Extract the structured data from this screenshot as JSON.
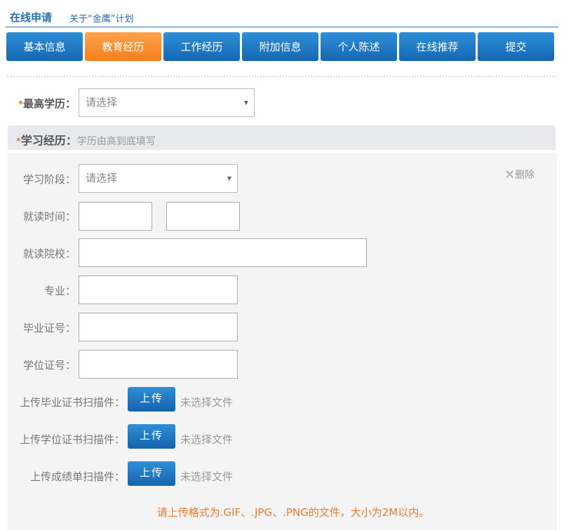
{
  "header": {
    "title": "在线申请",
    "about": "关于“金鹰”计划"
  },
  "tabs": [
    {
      "label": "基本信息",
      "active": false
    },
    {
      "label": "教育经历",
      "active": true
    },
    {
      "label": "工作经历",
      "active": false
    },
    {
      "label": "附加信息",
      "active": false
    },
    {
      "label": "个人陈述",
      "active": false
    },
    {
      "label": "在线推荐",
      "active": false
    },
    {
      "label": "提交",
      "active": false
    }
  ],
  "highest_degree": {
    "required_mark": "*",
    "label": "最高学历：",
    "placeholder": "请选择"
  },
  "study_section": {
    "required_mark": "*",
    "title": "学习经历：",
    "hint": "学历由高到底填写",
    "delete_label": "删除",
    "stage": {
      "label": "学习阶段：",
      "placeholder": "请选择"
    },
    "period": {
      "label": "就读时间："
    },
    "school": {
      "label": "就读院校："
    },
    "major": {
      "label": "专业："
    },
    "diploma_no": {
      "label": "毕业证号："
    },
    "degree_no": {
      "label": "学位证号："
    },
    "uploads": [
      {
        "label": "上传毕业证书扫描件：",
        "button": "上传",
        "status": "未选择文件"
      },
      {
        "label": "上传学位证书扫描件：",
        "button": "上传",
        "status": "未选择文件"
      },
      {
        "label": "上传成绩单扫描件：",
        "button": "上传",
        "status": "未选择文件"
      }
    ],
    "notice": "请上传格式为.GIF、.JPG、.PNG的文件，大小为2M以内。"
  },
  "colors": {
    "brand_blue": "#2a6fb5",
    "tab_blue": "#1a74c2",
    "tab_active_orange": "#f58a2a",
    "required_orange": "#f07a2a"
  }
}
